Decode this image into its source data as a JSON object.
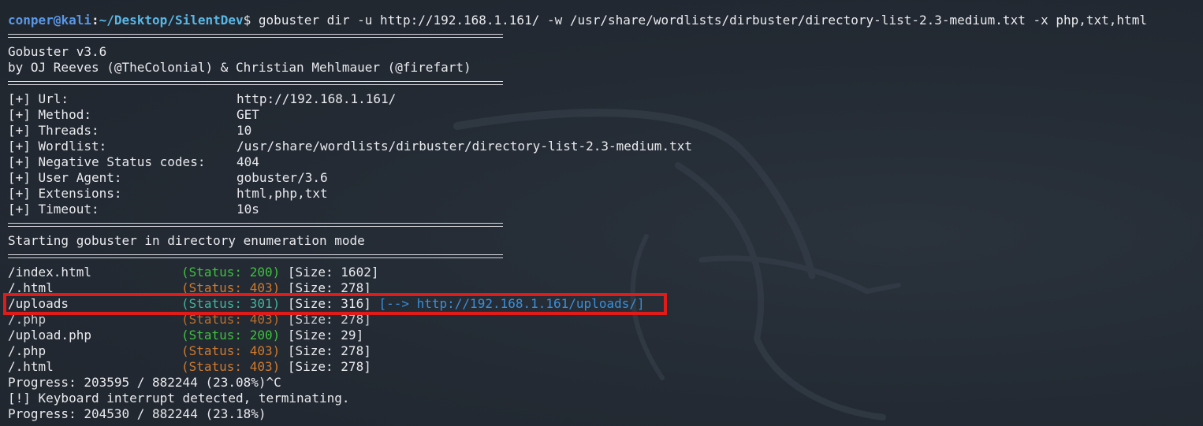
{
  "prompt": {
    "user": "conper",
    "at": "@",
    "host": "kali",
    "separator": ":",
    "path": "~/Desktop/SilentDev",
    "symbol": "$",
    "command": " gobuster dir -u http://192.168.1.161/ -w /usr/share/wordlists/dirbuster/directory-list-2.3-medium.txt -x php,txt,html"
  },
  "banner": {
    "line1": "Gobuster v3.6",
    "line2": "by OJ Reeves (@TheColonial) & Christian Mehlmauer (@firefart)"
  },
  "config": [
    {
      "key": "[+] Url:",
      "value": "http://192.168.1.161/"
    },
    {
      "key": "[+] Method:",
      "value": "GET"
    },
    {
      "key": "[+] Threads:",
      "value": "10"
    },
    {
      "key": "[+] Wordlist:",
      "value": "/usr/share/wordlists/dirbuster/directory-list-2.3-medium.txt"
    },
    {
      "key": "[+] Negative Status codes:",
      "value": "404"
    },
    {
      "key": "[+] User Agent:",
      "value": "gobuster/3.6"
    },
    {
      "key": "[+] Extensions:",
      "value": "html,php,txt"
    },
    {
      "key": "[+] Timeout:",
      "value": "10s"
    }
  ],
  "start_message": "Starting gobuster in directory enumeration mode",
  "results": [
    {
      "path": "/index.html",
      "status": "(Status: 200)",
      "status_color": "green",
      "size": " [Size: 1602]",
      "redirect": ""
    },
    {
      "path": "/.html",
      "status": "(Status: 403)",
      "status_color": "orange",
      "size": " [Size: 278]",
      "redirect": ""
    },
    {
      "path": "/uploads",
      "status": "(Status: 301)",
      "status_color": "teal",
      "size": " [Size: 316]",
      "redirect": " [--> http://192.168.1.161/uploads/]"
    },
    {
      "path": "/.php",
      "status": "(Status: 403)",
      "status_color": "orange",
      "size": " [Size: 278]",
      "redirect": ""
    },
    {
      "path": "/upload.php",
      "status": "(Status: 200)",
      "status_color": "green",
      "size": " [Size: 29]",
      "redirect": ""
    },
    {
      "path": "/.php",
      "status": "(Status: 403)",
      "status_color": "orange",
      "size": " [Size: 278]",
      "redirect": ""
    },
    {
      "path": "/.html",
      "status": "(Status: 403)",
      "status_color": "orange",
      "size": " [Size: 278]",
      "redirect": ""
    }
  ],
  "progress1": "Progress: 203595 / 882244 (23.08%)^C",
  "interrupt": "[!] Keyboard interrupt detected, terminating.",
  "progress2": "Progress: 204530 / 882244 (23.18%)",
  "colors": {
    "background": "#232a33",
    "highlight_box": "#e11a1a",
    "status_200": "#3ec23e",
    "status_403": "#d17a2c",
    "status_301": "#44b39c",
    "redirect": "#3a8fd9"
  },
  "background_image": "kali-dragon-logo"
}
